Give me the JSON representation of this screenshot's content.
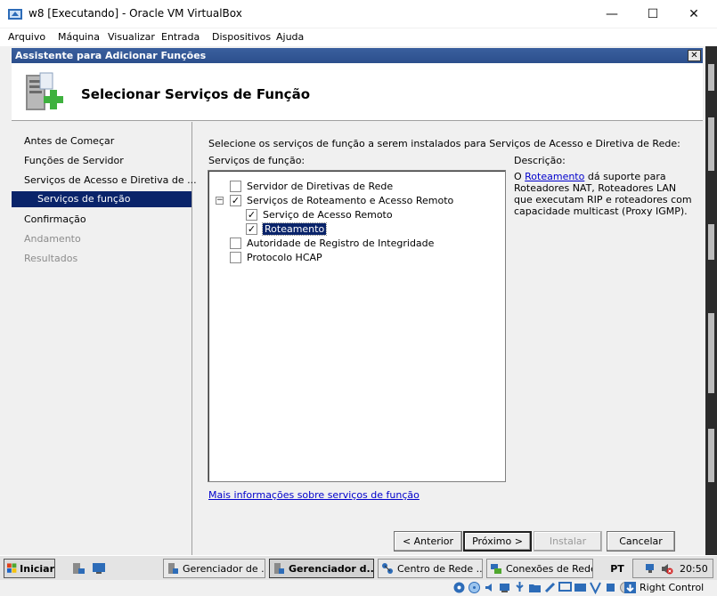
{
  "host": {
    "title": "w8 [Executando] - Oracle VM VirtualBox",
    "controls": {
      "minimize": "—",
      "maximize": "☐",
      "close": "✕"
    },
    "menu": [
      "Arquivo",
      "Máquina",
      "Visualizar",
      "Entrada",
      "Dispositivos",
      "Ajuda"
    ],
    "host_key": "Right Control"
  },
  "wizard": {
    "title": "Assistente para Adicionar Funções",
    "close_label": "✕",
    "header_title": "Selecionar Serviços de Função",
    "nav": [
      {
        "label": "Antes de Começar",
        "state": "normal"
      },
      {
        "label": "Funções de Servidor",
        "state": "normal"
      },
      {
        "label": "Serviços de Acesso e Diretiva de ...",
        "state": "normal"
      },
      {
        "label": "Serviços de função",
        "state": "active"
      },
      {
        "label": "Confirmação",
        "state": "normal"
      },
      {
        "label": "Andamento",
        "state": "disabled"
      },
      {
        "label": "Resultados",
        "state": "disabled"
      }
    ],
    "intro": "Selecione os serviços de função a serem instalados para Serviços de Acesso e Diretiva de Rede:",
    "list_label": "Serviços de função:",
    "tree": [
      {
        "label": "Servidor de Diretivas de Rede",
        "checked": false,
        "level": 0,
        "expander": ""
      },
      {
        "label": "Serviços de Roteamento e Acesso Remoto",
        "checked": true,
        "level": 0,
        "expander": "−"
      },
      {
        "label": "Serviço de Acesso Remoto",
        "checked": true,
        "level": 1,
        "expander": ""
      },
      {
        "label": "Roteamento",
        "checked": true,
        "level": 1,
        "expander": "",
        "selected": true
      },
      {
        "label": "Autoridade de Registro de Integridade",
        "checked": false,
        "level": 0,
        "expander": ""
      },
      {
        "label": "Protocolo HCAP",
        "checked": false,
        "level": 0,
        "expander": ""
      }
    ],
    "description_label": "Descrição:",
    "description": {
      "prefix": "O ",
      "link": "Roteamento",
      "rest": " dá suporte para Roteadores NAT, Roteadores LAN que executam RIP e roteadores com capacidade multicast (Proxy IGMP)."
    },
    "more_info_link": "Mais informações sobre serviços de função",
    "buttons": {
      "back": "< Anterior",
      "next": "Próximo >",
      "install": "Instalar",
      "cancel": "Cancelar"
    }
  },
  "taskbar": {
    "start": "Iniciar",
    "tasks": [
      {
        "label": "Gerenciador de ...",
        "active": false
      },
      {
        "label": "Gerenciador d...",
        "active": true
      },
      {
        "label": "Centro de Rede ...",
        "active": false
      },
      {
        "label": "Conexões de Rede",
        "active": false
      }
    ],
    "language": "PT",
    "clock": "20:50"
  },
  "colors": {
    "selection": "#0a246a",
    "wizard_title": "#2c4f8c",
    "link": "#0000cc"
  }
}
